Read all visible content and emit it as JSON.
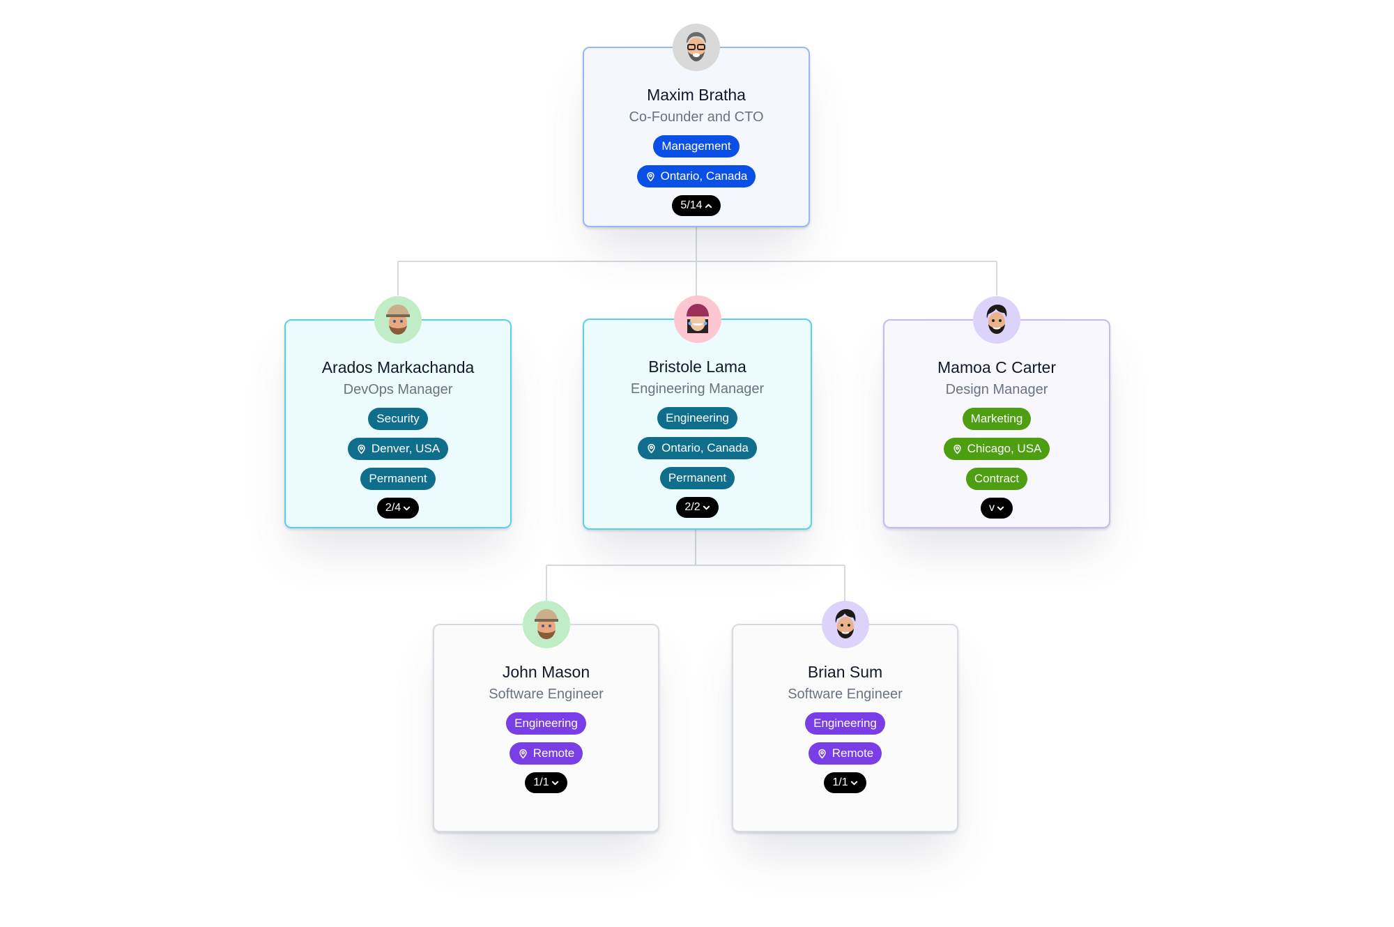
{
  "org_chart": {
    "colors": {
      "management": "#0a4fe6",
      "teal": "#0e6e8c",
      "green": "#4d9e10",
      "purple": "#7a3ee6",
      "connector": "#d5d9e0"
    },
    "nodes": {
      "maxim": {
        "name": "Maxim Bratha",
        "title": "Co-Founder and CTO",
        "department": "Management",
        "location": "Ontario, Canada",
        "count": "5/14",
        "toggle_icon": "chevron-up-icon",
        "avatar_bg": "#d9d9d9"
      },
      "arados": {
        "name": "Arados Markachanda",
        "title": "DevOps Manager",
        "department": "Security",
        "location": "Denver, USA",
        "employment": "Permanent",
        "count": "2/4",
        "toggle_icon": "chevron-down-icon",
        "avatar_bg": "#c0ecc6"
      },
      "bristole": {
        "name": "Bristole Lama",
        "title": "Engineering Manager",
        "department": "Engineering",
        "location": "Ontario, Canada",
        "employment": "Permanent",
        "count": "2/2",
        "toggle_icon": "chevron-down-icon",
        "avatar_bg": "#fdc6d1"
      },
      "mamoa": {
        "name": "Mamoa C Carter",
        "title": "Design Manager",
        "department": "Marketing",
        "location": "Chicago, USA",
        "employment": "Contract",
        "count": "v",
        "toggle_icon": "chevron-down-icon",
        "avatar_bg": "#dcd3fb"
      },
      "john": {
        "name": "John Mason",
        "title": "Software Engineer",
        "department": "Engineering",
        "location": "Remote",
        "count": "1/1",
        "toggle_icon": "chevron-down-icon",
        "avatar_bg": "#c0ecc6"
      },
      "brian": {
        "name": "Brian Sum",
        "title": "Software Engineer",
        "department": "Engineering",
        "location": "Remote",
        "count": "1/1",
        "toggle_icon": "chevron-down-icon",
        "avatar_bg": "#dcd3fb"
      }
    }
  }
}
